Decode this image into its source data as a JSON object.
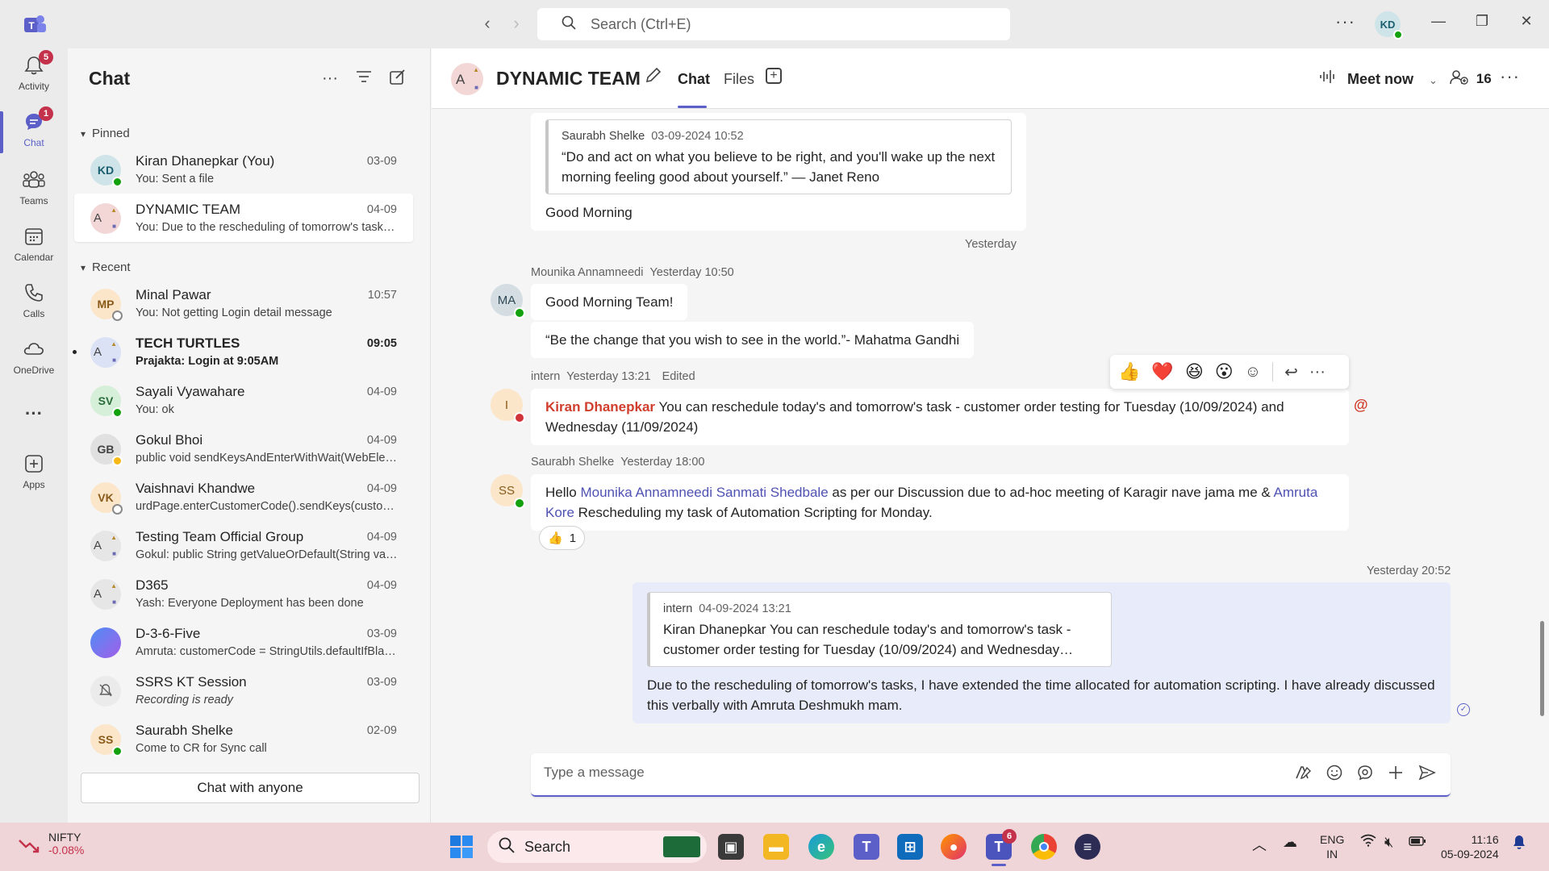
{
  "titlebar": {
    "search_placeholder": "Search (Ctrl+E)",
    "avatar_initials": "KD",
    "more": "···"
  },
  "rail": {
    "items": [
      {
        "label": "Activity",
        "badge": "5"
      },
      {
        "label": "Chat",
        "badge": "1"
      },
      {
        "label": "Teams"
      },
      {
        "label": "Calendar"
      },
      {
        "label": "Calls"
      },
      {
        "label": "OneDrive"
      },
      {
        "label": "···"
      },
      {
        "label": "Apps"
      }
    ]
  },
  "chatlist": {
    "title": "Chat",
    "pinned_label": "Pinned",
    "recent_label": "Recent",
    "pinned": [
      {
        "initials": "KD",
        "name": "Kiran Dhanepkar (You)",
        "preview": "You: Sent a file",
        "date": "03-09"
      },
      {
        "initials": "A",
        "name": "DYNAMIC TEAM",
        "preview": "You: Due to the rescheduling of tomorrow's tasks, I have extended the time",
        "date": "04-09"
      }
    ],
    "recent": [
      {
        "initials": "MP",
        "name": "Minal Pawar",
        "preview": "You: Not getting Login detail message",
        "date": "10:57"
      },
      {
        "initials": "A",
        "name": "TECH TURTLES",
        "preview": "Prajakta: Login at 9:05AM",
        "date": "09:05"
      },
      {
        "initials": "SV",
        "name": "Sayali Vyawahare",
        "preview": "You: ok",
        "date": "04-09"
      },
      {
        "initials": "GB",
        "name": "Gokul Bhoi",
        "preview": "public void sendKeysAndEnterWithWait(WebElement element)",
        "date": "04-09"
      },
      {
        "initials": "VK",
        "name": "Vaishnavi Khandwe",
        "preview": "urdPage.enterCustomerCode().sendKeys(customerCode)",
        "date": "04-09"
      },
      {
        "initials": "A",
        "name": "Testing Team Official Group",
        "preview": "Gokul: public String getValueOrDefault(String value)",
        "date": "04-09"
      },
      {
        "initials": "A",
        "name": "D365",
        "preview": "Yash: Everyone Deployment has been done",
        "date": "04-09"
      },
      {
        "initials": "",
        "name": "D-3-6-Five",
        "preview": "Amruta: customerCode = StringUtils.defaultIfBlank()",
        "date": "03-09"
      },
      {
        "initials": "",
        "name": "SSRS KT Session",
        "preview": "Recording is ready",
        "date": "03-09"
      },
      {
        "initials": "SS",
        "name": "Saurabh Shelke",
        "preview": "Come to CR for Sync call",
        "date": "02-09"
      }
    ],
    "chat_anyone": "Chat with anyone"
  },
  "header": {
    "title": "DYNAMIC TEAM",
    "tab_chat": "Chat",
    "tab_files": "Files",
    "meet_now": "Meet now",
    "participants": "16"
  },
  "messages": {
    "m1": {
      "quote_author": "Saurabh Shelke",
      "quote_time": "03-09-2024 10:52",
      "quote_text": "“Do and act on what you believe to be right, and you'll wake up the next morning feeling good about yourself.” — Janet Reno",
      "text": "Good Morning"
    },
    "day_separator": "Yesterday",
    "m2": {
      "author": "Mounika Annamneedi",
      "time": "Yesterday 10:50",
      "initials": "MA",
      "text1": "Good Morning Team!",
      "text2": "“Be the change that you wish to see in the world.”- Mahatma Gandhi"
    },
    "m3": {
      "author": "intern",
      "time": "Yesterday 13:21",
      "edited": "Edited",
      "initials": "I",
      "mention": "Kiran Dhanepkar",
      "text": " You can reschedule today's and tomorrow's task - customer order testing for Tuesday (10/09/2024) and Wednesday (11/09/2024)",
      "at": "@"
    },
    "m4": {
      "author": "Saurabh Shelke",
      "time": "Yesterday 18:00",
      "initials": "SS",
      "t1": "Hello ",
      "link1": "Mounika Annamneedi",
      "t2": " ",
      "link2": "Sanmati Shedbale",
      "t3": " as per our Discussion due to ad-hoc meeting of Karagir nave jama me & ",
      "link3": "Amruta Kore",
      "t4": " Rescheduling my task of Automation Scripting for Monday.",
      "reaction_emoji": "👍",
      "reaction_count": "1"
    },
    "m5": {
      "time": "Yesterday 20:52",
      "quote_author": "intern",
      "quote_time": "04-09-2024 13:21",
      "quote_text": "Kiran Dhanepkar You can reschedule today's and tomorrow's task - customer order testing for Tuesday (10/09/2024) and Wednesday…",
      "text": "Due to the rescheduling of tomorrow's tasks, I have extended the time allocated for automation scripting. I have already discussed this verbally with Amruta Deshmukh mam."
    }
  },
  "composer": {
    "placeholder": "Type a message"
  },
  "taskbar": {
    "stock_name": "NIFTY",
    "stock_value": "-0.08%",
    "search": "Search",
    "lang1": "ENG",
    "lang2": "IN",
    "time": "11:16",
    "date": "05-09-2024",
    "teams_badge": "6"
  },
  "colors": {
    "accent": "#5b5fc7",
    "mention": "#d03d2c",
    "online": "#13a10e"
  }
}
